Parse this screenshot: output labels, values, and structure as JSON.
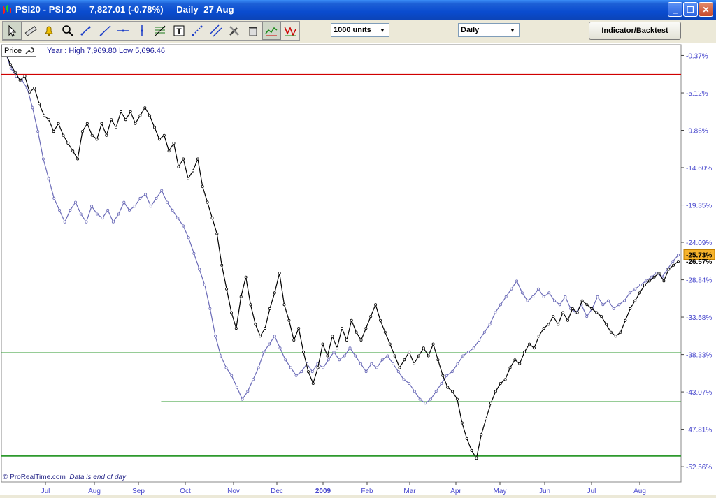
{
  "window": {
    "title": "PSI20 - PSI 20     7,827.01 (-0.78%)     Daily  27 Aug",
    "minimize_icon": "minimize-icon",
    "restore_icon": "restore-icon",
    "close_icon": "close-icon"
  },
  "toolbar": {
    "tools": [
      "pointer-icon",
      "ruler-icon",
      "alarm-bell-icon",
      "zoom-icon",
      "trendline-icon",
      "ray-icon",
      "horizontal-line-icon",
      "vertical-line-icon",
      "fibonacci-icon",
      "text-tool-icon",
      "arrow-line-icon",
      "parallel-lines-icon",
      "tools-icon",
      "trash-icon",
      "overlay-chart-icon",
      "pattern-icon"
    ],
    "selected_tool": "pointer-icon",
    "units_dropdown": "1000 units",
    "period_dropdown": "Daily",
    "indicator_button": "Indicator/Backtest"
  },
  "chart_header": {
    "price_label": "Price",
    "range_text": "Year : High 7,969.80 Low 5,696.46"
  },
  "footer": {
    "brand": "© ProRealTime.com",
    "note": "Data is end of day"
  },
  "colors": {
    "primary_series": "#000000",
    "comparison_series": "#6c6cb8",
    "red_line": "#d00000",
    "green_line": "#2e9a2e",
    "axis_text": "#4444cc",
    "badge_bg": "#f7b32b"
  },
  "chart_data": {
    "type": "line",
    "x_tick_labels": [
      "Jul",
      "Aug",
      "Sep",
      "Oct",
      "Nov",
      "Dec",
      "2009",
      "Feb",
      "Mar",
      "Apr",
      "May",
      "Jun",
      "Jul",
      "Aug"
    ],
    "y_tick_labels": [
      "-0.37%",
      "-5.12%",
      "-9.86%",
      "-14.60%",
      "-19.35%",
      "-24.09%",
      "-28.84%",
      "-33.58%",
      "-38.33%",
      "-43.07%",
      "-47.81%",
      "-52.56%"
    ],
    "y_unit": "%",
    "ylim": [
      -54.5,
      1.0
    ],
    "current_values": [
      "-25.73%",
      "-26.57%"
    ],
    "series": [
      {
        "values": [
          0.0,
          -1.5,
          -2.5,
          -3.5,
          -3.0,
          -5.0,
          -4.5,
          -6.5,
          -8.0,
          -8.5,
          -10.0,
          -9.0,
          -10.5,
          -11.5,
          -12.5,
          -13.5,
          -10.0,
          -9.0,
          -10.5,
          -11.0,
          -9.0,
          -10.5,
          -8.5,
          -9.5,
          -7.5,
          -8.5,
          -7.5,
          -9.0,
          -8.0,
          -7.0,
          -8.0,
          -9.5,
          -11.0,
          -10.5,
          -12.5,
          -11.5,
          -14.5,
          -13.5,
          -16.0,
          -15.0,
          -13.5,
          -17.0,
          -19.0,
          -21.0,
          -23.0,
          -27.0,
          -30.0,
          -33.0,
          -35.0,
          -31.0,
          -28.5,
          -32.0,
          -34.5,
          -36.0,
          -35.0,
          -32.5,
          -30.5,
          -28.0,
          -32.0,
          -34.0,
          -36.5,
          -35.0,
          -38.0,
          -40.5,
          -42.0,
          -40.0,
          -37.0,
          -38.5,
          -36.0,
          -37.5,
          -35.0,
          -36.5,
          -34.0,
          -35.5,
          -36.5,
          -35.0,
          -33.5,
          -32.0,
          -34.0,
          -35.5,
          -37.0,
          -38.5,
          -40.0,
          -39.0,
          -38.0,
          -39.5,
          -38.5,
          -37.5,
          -38.5,
          -37.0,
          -39.0,
          -41.0,
          -42.5,
          -43.0,
          -44.0,
          -47.0,
          -49.0,
          -50.5,
          -51.5,
          -48.5,
          -46.5,
          -44.5,
          -43.0,
          -42.0,
          -41.5,
          -40.0,
          -39.0,
          -39.5,
          -38.0,
          -37.0,
          -37.5,
          -36.0,
          -35.0,
          -34.5,
          -33.5,
          -34.5,
          -33.0,
          -34.0,
          -32.5,
          -33.0,
          -31.5,
          -32.0,
          -32.5,
          -33.0,
          -33.5,
          -34.5,
          -35.5,
          -36.0,
          -35.5,
          -34.0,
          -32.5,
          -31.5,
          -30.5,
          -29.5,
          -29.0,
          -28.5,
          -28.0,
          -29.0,
          -27.5,
          -27.0,
          -26.5
        ]
      },
      {
        "values": [
          0.0,
          -2.0,
          -3.0,
          -3.5,
          -4.5,
          -7.0,
          -10.0,
          -13.5,
          -16.0,
          -18.5,
          -20.0,
          -21.5,
          -20.0,
          -19.0,
          -20.5,
          -21.5,
          -19.5,
          -20.5,
          -21.0,
          -20.0,
          -21.5,
          -20.5,
          -19.0,
          -20.0,
          -19.5,
          -18.5,
          -18.0,
          -19.5,
          -18.5,
          -17.5,
          -19.0,
          -20.0,
          -21.0,
          -22.0,
          -23.5,
          -25.5,
          -27.5,
          -29.5,
          -32.5,
          -36.0,
          -38.5,
          -40.0,
          -41.0,
          -42.5,
          -44.0,
          -43.0,
          -41.5,
          -40.0,
          -38.0,
          -37.0,
          -36.0,
          -37.5,
          -39.0,
          -40.0,
          -41.0,
          -40.5,
          -39.5,
          -40.5,
          -39.5,
          -40.0,
          -39.0,
          -38.0,
          -39.0,
          -38.5,
          -37.5,
          -38.5,
          -39.5,
          -40.5,
          -39.5,
          -40.0,
          -39.0,
          -38.5,
          -39.5,
          -40.5,
          -41.5,
          -42.0,
          -43.0,
          -44.0,
          -44.5,
          -44.0,
          -43.0,
          -42.0,
          -41.0,
          -40.5,
          -39.5,
          -38.5,
          -38.0,
          -37.5,
          -36.5,
          -35.5,
          -34.5,
          -33.0,
          -32.0,
          -31.0,
          -30.0,
          -29.0,
          -30.5,
          -31.5,
          -31.0,
          -30.0,
          -31.0,
          -30.5,
          -31.5,
          -32.0,
          -31.0,
          -32.5,
          -33.0,
          -32.0,
          -33.5,
          -32.5,
          -31.0,
          -32.0,
          -31.5,
          -32.5,
          -32.0,
          -31.5,
          -30.5,
          -30.0,
          -29.5,
          -29.0,
          -28.5,
          -28.0,
          -28.5,
          -27.5,
          -26.5,
          -25.7
        ]
      }
    ],
    "horizontal_lines": [
      {
        "value": -2.8,
        "color": "red",
        "x_start_fraction": 0.0
      },
      {
        "value": -29.9,
        "color": "green",
        "x_start_fraction": 0.665
      },
      {
        "value": -38.1,
        "color": "green",
        "x_start_fraction": 0.0
      },
      {
        "value": -44.3,
        "color": "green",
        "x_start_fraction": 0.235
      },
      {
        "value": -51.2,
        "color": "green",
        "x_start_fraction": 0.0
      }
    ],
    "grid": false
  }
}
